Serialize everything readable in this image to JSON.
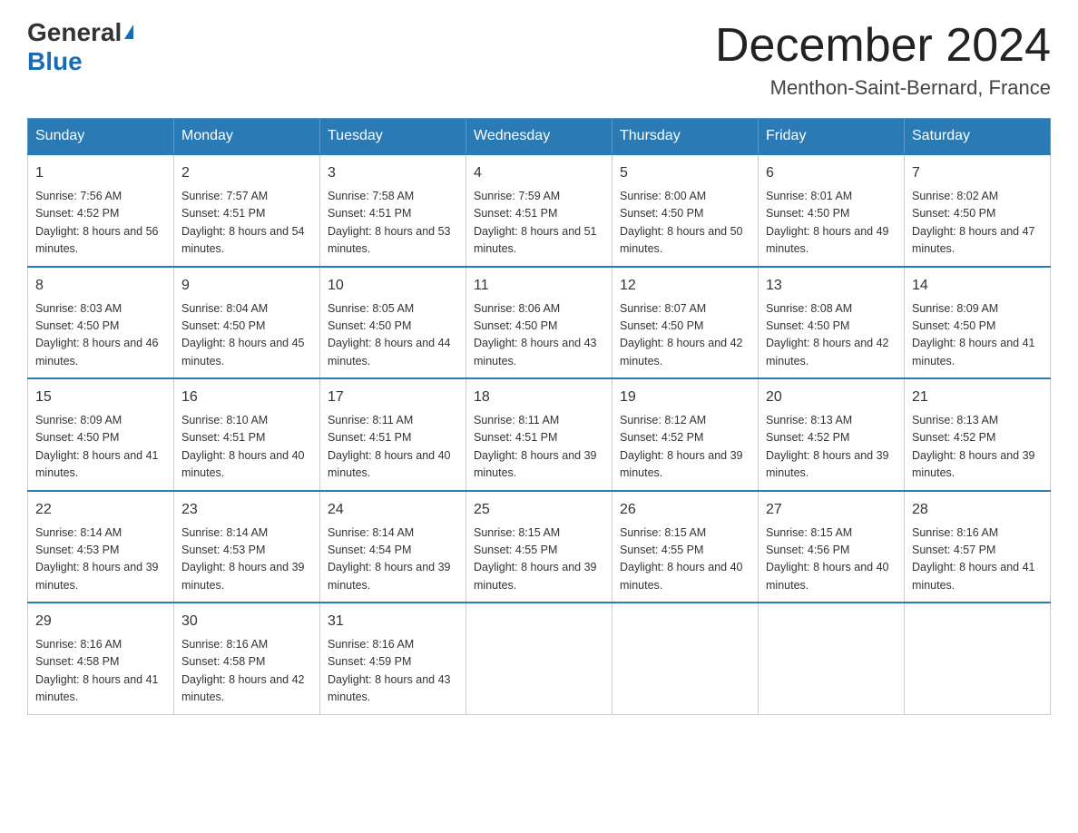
{
  "header": {
    "logo_general": "General",
    "logo_blue": "Blue",
    "title": "December 2024",
    "subtitle": "Menthon-Saint-Bernard, France"
  },
  "days_of_week": [
    "Sunday",
    "Monday",
    "Tuesday",
    "Wednesday",
    "Thursday",
    "Friday",
    "Saturday"
  ],
  "weeks": [
    [
      {
        "day": "1",
        "sunrise": "7:56 AM",
        "sunset": "4:52 PM",
        "daylight": "8 hours and 56 minutes."
      },
      {
        "day": "2",
        "sunrise": "7:57 AM",
        "sunset": "4:51 PM",
        "daylight": "8 hours and 54 minutes."
      },
      {
        "day": "3",
        "sunrise": "7:58 AM",
        "sunset": "4:51 PM",
        "daylight": "8 hours and 53 minutes."
      },
      {
        "day": "4",
        "sunrise": "7:59 AM",
        "sunset": "4:51 PM",
        "daylight": "8 hours and 51 minutes."
      },
      {
        "day": "5",
        "sunrise": "8:00 AM",
        "sunset": "4:50 PM",
        "daylight": "8 hours and 50 minutes."
      },
      {
        "day": "6",
        "sunrise": "8:01 AM",
        "sunset": "4:50 PM",
        "daylight": "8 hours and 49 minutes."
      },
      {
        "day": "7",
        "sunrise": "8:02 AM",
        "sunset": "4:50 PM",
        "daylight": "8 hours and 47 minutes."
      }
    ],
    [
      {
        "day": "8",
        "sunrise": "8:03 AM",
        "sunset": "4:50 PM",
        "daylight": "8 hours and 46 minutes."
      },
      {
        "day": "9",
        "sunrise": "8:04 AM",
        "sunset": "4:50 PM",
        "daylight": "8 hours and 45 minutes."
      },
      {
        "day": "10",
        "sunrise": "8:05 AM",
        "sunset": "4:50 PM",
        "daylight": "8 hours and 44 minutes."
      },
      {
        "day": "11",
        "sunrise": "8:06 AM",
        "sunset": "4:50 PM",
        "daylight": "8 hours and 43 minutes."
      },
      {
        "day": "12",
        "sunrise": "8:07 AM",
        "sunset": "4:50 PM",
        "daylight": "8 hours and 42 minutes."
      },
      {
        "day": "13",
        "sunrise": "8:08 AM",
        "sunset": "4:50 PM",
        "daylight": "8 hours and 42 minutes."
      },
      {
        "day": "14",
        "sunrise": "8:09 AM",
        "sunset": "4:50 PM",
        "daylight": "8 hours and 41 minutes."
      }
    ],
    [
      {
        "day": "15",
        "sunrise": "8:09 AM",
        "sunset": "4:50 PM",
        "daylight": "8 hours and 41 minutes."
      },
      {
        "day": "16",
        "sunrise": "8:10 AM",
        "sunset": "4:51 PM",
        "daylight": "8 hours and 40 minutes."
      },
      {
        "day": "17",
        "sunrise": "8:11 AM",
        "sunset": "4:51 PM",
        "daylight": "8 hours and 40 minutes."
      },
      {
        "day": "18",
        "sunrise": "8:11 AM",
        "sunset": "4:51 PM",
        "daylight": "8 hours and 39 minutes."
      },
      {
        "day": "19",
        "sunrise": "8:12 AM",
        "sunset": "4:52 PM",
        "daylight": "8 hours and 39 minutes."
      },
      {
        "day": "20",
        "sunrise": "8:13 AM",
        "sunset": "4:52 PM",
        "daylight": "8 hours and 39 minutes."
      },
      {
        "day": "21",
        "sunrise": "8:13 AM",
        "sunset": "4:52 PM",
        "daylight": "8 hours and 39 minutes."
      }
    ],
    [
      {
        "day": "22",
        "sunrise": "8:14 AM",
        "sunset": "4:53 PM",
        "daylight": "8 hours and 39 minutes."
      },
      {
        "day": "23",
        "sunrise": "8:14 AM",
        "sunset": "4:53 PM",
        "daylight": "8 hours and 39 minutes."
      },
      {
        "day": "24",
        "sunrise": "8:14 AM",
        "sunset": "4:54 PM",
        "daylight": "8 hours and 39 minutes."
      },
      {
        "day": "25",
        "sunrise": "8:15 AM",
        "sunset": "4:55 PM",
        "daylight": "8 hours and 39 minutes."
      },
      {
        "day": "26",
        "sunrise": "8:15 AM",
        "sunset": "4:55 PM",
        "daylight": "8 hours and 40 minutes."
      },
      {
        "day": "27",
        "sunrise": "8:15 AM",
        "sunset": "4:56 PM",
        "daylight": "8 hours and 40 minutes."
      },
      {
        "day": "28",
        "sunrise": "8:16 AM",
        "sunset": "4:57 PM",
        "daylight": "8 hours and 41 minutes."
      }
    ],
    [
      {
        "day": "29",
        "sunrise": "8:16 AM",
        "sunset": "4:58 PM",
        "daylight": "8 hours and 41 minutes."
      },
      {
        "day": "30",
        "sunrise": "8:16 AM",
        "sunset": "4:58 PM",
        "daylight": "8 hours and 42 minutes."
      },
      {
        "day": "31",
        "sunrise": "8:16 AM",
        "sunset": "4:59 PM",
        "daylight": "8 hours and 43 minutes."
      },
      null,
      null,
      null,
      null
    ]
  ]
}
